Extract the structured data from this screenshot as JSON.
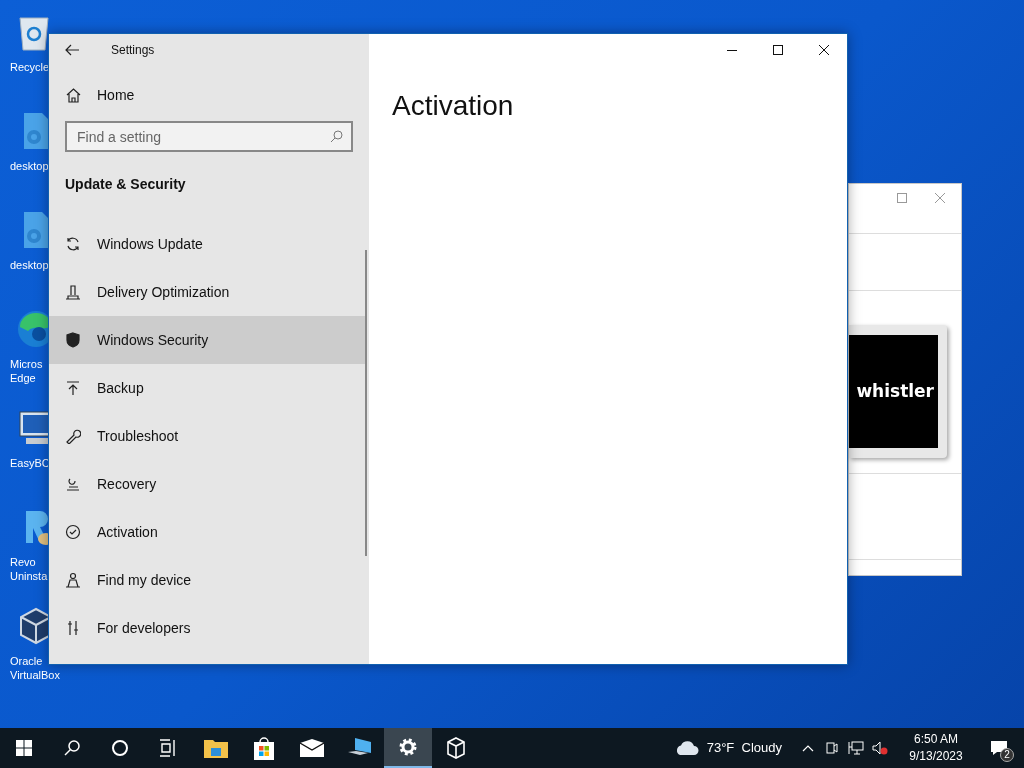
{
  "desktop_icons": [
    {
      "kind": "recycle",
      "lines": [
        "Recycle"
      ]
    },
    {
      "kind": "gear",
      "lines": [
        "desktop"
      ]
    },
    {
      "kind": "gear",
      "lines": [
        "desktop"
      ]
    },
    {
      "kind": "edge",
      "lines": [
        "Micros",
        "Edge"
      ]
    },
    {
      "kind": "monitor",
      "lines": [
        "EasyBC"
      ]
    },
    {
      "kind": "revo",
      "lines": [
        "Revo",
        "Uninsta"
      ]
    },
    {
      "kind": "cube",
      "lines": [
        "Oracle",
        "VirtualBox"
      ]
    }
  ],
  "background_window": {
    "image_text": "whistler"
  },
  "settings_window": {
    "title": "Settings",
    "home": "Home",
    "search": {
      "placeholder": "Find a setting"
    },
    "section": "Update & Security",
    "nav_items": [
      {
        "kind": "refresh",
        "label": "Windows Update",
        "hovered": false
      },
      {
        "kind": "delivery",
        "label": "Delivery Optimization",
        "hovered": false
      },
      {
        "kind": "shield",
        "label": "Windows Security",
        "hovered": true
      },
      {
        "kind": "backup",
        "label": "Backup",
        "hovered": false
      },
      {
        "kind": "wrench",
        "label": "Troubleshoot",
        "hovered": false
      },
      {
        "kind": "recovery",
        "label": "Recovery",
        "hovered": false
      },
      {
        "kind": "check",
        "label": "Activation",
        "hovered": false
      },
      {
        "kind": "person",
        "label": "Find my device",
        "hovered": false
      },
      {
        "kind": "dev",
        "label": "For developers",
        "hovered": false
      }
    ],
    "page_title": "Activation"
  },
  "taskbar": {
    "apps": [
      {
        "kind": "start",
        "active": false
      },
      {
        "kind": "search",
        "active": false
      },
      {
        "kind": "cortana",
        "active": false
      },
      {
        "kind": "taskview",
        "active": false
      },
      {
        "kind": "folder",
        "active": false
      },
      {
        "kind": "store",
        "active": false
      },
      {
        "kind": "mail",
        "active": false
      },
      {
        "kind": "pc",
        "active": false
      },
      {
        "kind": "gear",
        "active": true
      },
      {
        "kind": "cube",
        "active": false
      }
    ],
    "weather": "73°F  Cloudy",
    "time": "6:50 AM",
    "date": "9/13/2023",
    "notifications": "2"
  }
}
